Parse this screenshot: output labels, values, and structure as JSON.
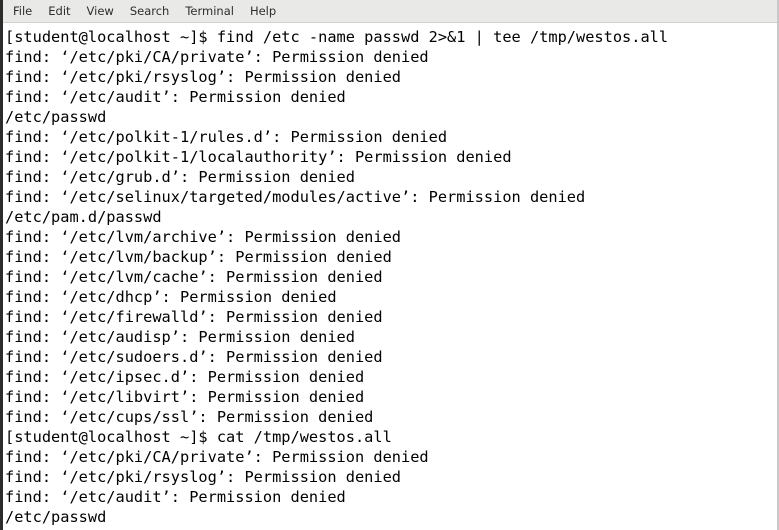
{
  "window": {
    "type": "gnome-terminal",
    "background_color": "#ffffff",
    "foreground_color": "#000000",
    "menubar_color": "#e9e9e7"
  },
  "menubar": {
    "items": [
      {
        "label": "File"
      },
      {
        "label": "Edit"
      },
      {
        "label": "View"
      },
      {
        "label": "Search"
      },
      {
        "label": "Terminal"
      },
      {
        "label": "Help"
      }
    ]
  },
  "terminal": {
    "prompt": "[student@localhost ~]$",
    "lines": [
      "[student@localhost ~]$ find /etc -name passwd 2>&1 | tee /tmp/westos.all",
      "find: ‘/etc/pki/CA/private’: Permission denied",
      "find: ‘/etc/pki/rsyslog’: Permission denied",
      "find: ‘/etc/audit’: Permission denied",
      "/etc/passwd",
      "find: ‘/etc/polkit-1/rules.d’: Permission denied",
      "find: ‘/etc/polkit-1/localauthority’: Permission denied",
      "find: ‘/etc/grub.d’: Permission denied",
      "find: ‘/etc/selinux/targeted/modules/active’: Permission denied",
      "/etc/pam.d/passwd",
      "find: ‘/etc/lvm/archive’: Permission denied",
      "find: ‘/etc/lvm/backup’: Permission denied",
      "find: ‘/etc/lvm/cache’: Permission denied",
      "find: ‘/etc/dhcp’: Permission denied",
      "find: ‘/etc/firewalld’: Permission denied",
      "find: ‘/etc/audisp’: Permission denied",
      "find: ‘/etc/sudoers.d’: Permission denied",
      "find: ‘/etc/ipsec.d’: Permission denied",
      "find: ‘/etc/libvirt’: Permission denied",
      "find: ‘/etc/cups/ssl’: Permission denied",
      "[student@localhost ~]$ cat /tmp/westos.all",
      "find: ‘/etc/pki/CA/private’: Permission denied",
      "find: ‘/etc/pki/rsyslog’: Permission denied",
      "find: ‘/etc/audit’: Permission denied",
      "/etc/passwd"
    ]
  }
}
